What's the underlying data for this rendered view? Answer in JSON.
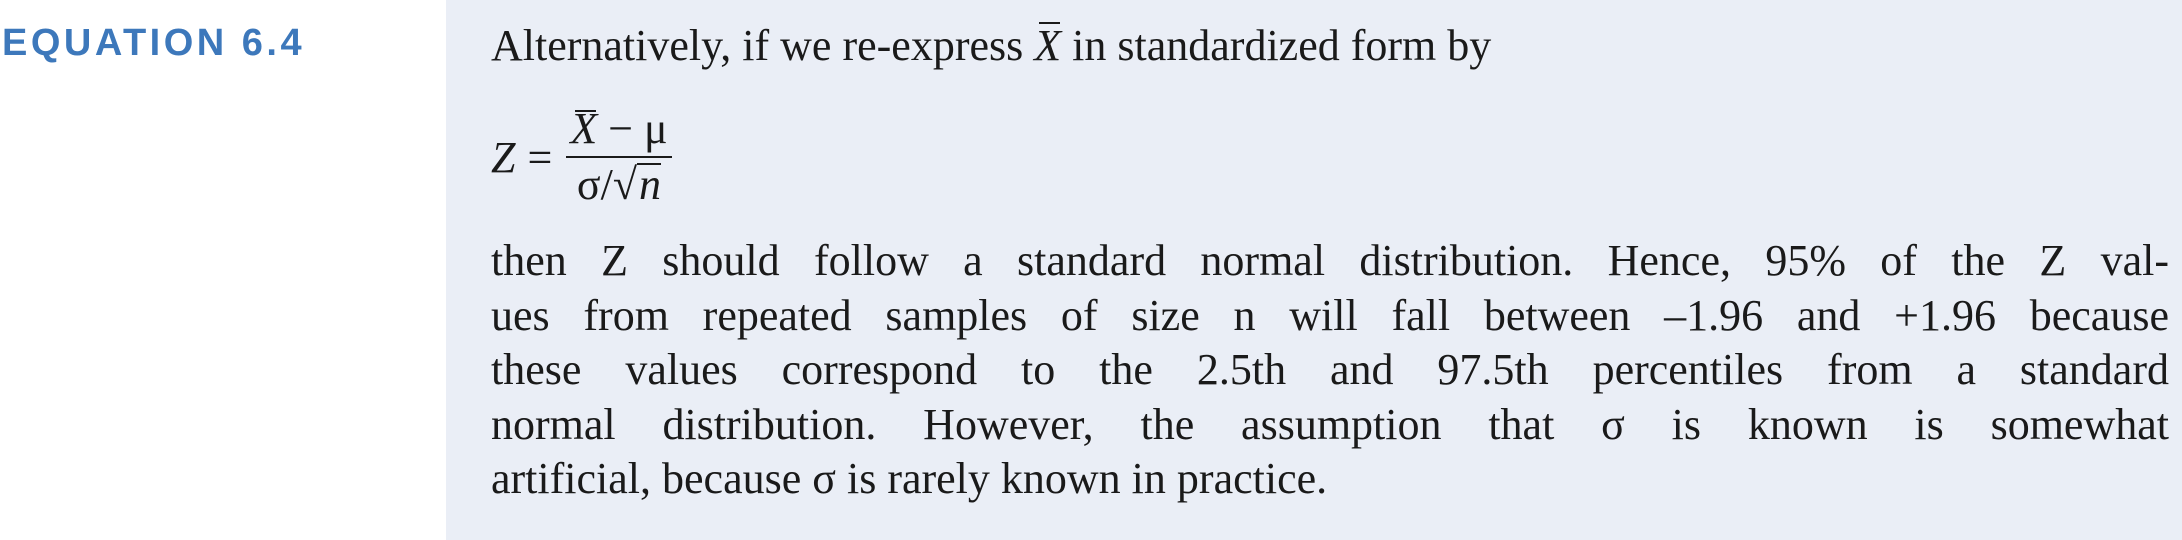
{
  "label": {
    "text": "EQUATION 6.4",
    "color": "#3d78bb"
  },
  "panel": {
    "background": "#eaeef6"
  },
  "intro": {
    "before": "Alternatively, if we re-express ",
    "symbol": "X",
    "after": " in standardized form by"
  },
  "formula": {
    "lhs": "Z",
    "equals": "=",
    "numerator_var": "X",
    "numerator_rest": " − μ",
    "denominator_sigma": "σ/",
    "radical": "√",
    "radicand": "n"
  },
  "paragraph": {
    "lines": [
      "then Z should follow a standard normal distribution. Hence, 95% of the Z val-",
      "ues from repeated samples of size n will fall between –1.96 and +1.96 because",
      "these values correspond to the 2.5th and 97.5th percentiles from a standard",
      "normal distribution. However, the assumption that σ is known is somewhat",
      "artificial, because σ is rarely known in practice."
    ]
  }
}
